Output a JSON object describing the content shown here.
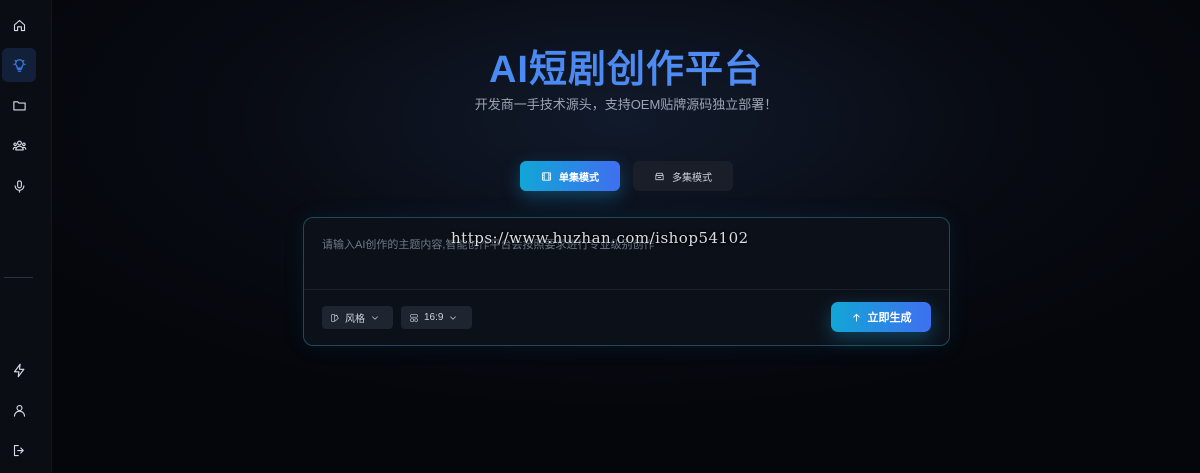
{
  "sidebar": {
    "items": [
      {
        "icon": "home-icon"
      },
      {
        "icon": "lightbulb-icon",
        "active": true
      },
      {
        "icon": "folder-icon"
      },
      {
        "icon": "users-icon"
      },
      {
        "icon": "microphone-icon"
      },
      {
        "icon": "lightning-icon"
      },
      {
        "icon": "user-icon"
      },
      {
        "icon": "logout-icon"
      }
    ]
  },
  "header": {
    "title": "AI短剧创作平台",
    "subtitle": "开发商一手技术源头，支持OEM贴牌源码独立部署！"
  },
  "modes": {
    "single_label": "单集模式",
    "multi_label": "多集模式"
  },
  "prompt": {
    "placeholder": "请输入AI创作的主题内容,智能创作平台会按照要求进行专业级别创作",
    "value": ""
  },
  "watermark": "https://www.huzhan.com/ishop54102",
  "options": {
    "style_label": "风格",
    "ratio_label": "16:9"
  },
  "actions": {
    "generate_label": "立即生成"
  },
  "colors": {
    "accent": "#3b82f6",
    "button_gradient_start": "#12a6d6",
    "button_gradient_end": "#3f6ff0",
    "background": "#05070d"
  }
}
